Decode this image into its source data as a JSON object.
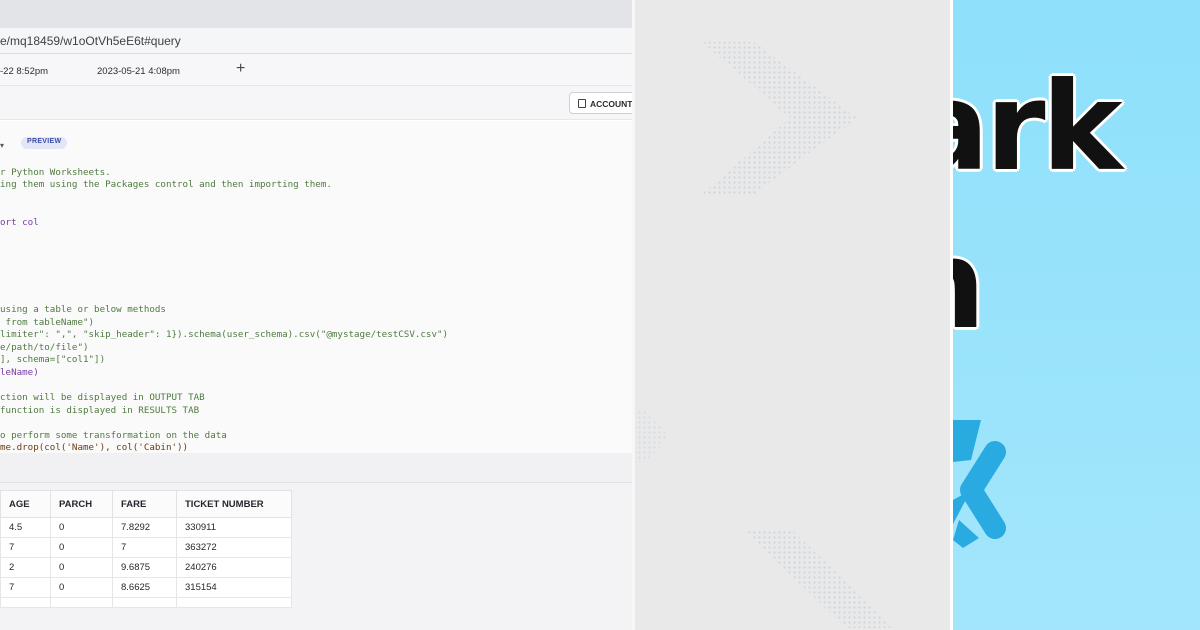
{
  "browser": {
    "address": "e/mq18459/w1oOtVh5eE6t#query"
  },
  "tabs": [
    {
      "label": "-22 8:52pm"
    },
    {
      "label": "2023-05-21 4:08pm"
    }
  ],
  "add_tab_glyph": "+",
  "toolbar": {
    "account_label": "ACCOUNT"
  },
  "editor": {
    "dropdown_glyph": "▾",
    "badge": "PREVIEW",
    "lines": [
      {
        "text": "r Python Worksheets.",
        "kind": "comment"
      },
      {
        "text": "ing them using the Packages control and then importing them.",
        "kind": "comment"
      },
      {
        "text": "ort col",
        "kind": "kw"
      },
      {
        "text": "using a table or below methods",
        "kind": "comment"
      },
      {
        "text": " from tableName\")",
        "kind": "comment"
      },
      {
        "text": "limiter\": \",\", \"skip_header\": 1}).schema(user_schema).csv(\"@mystage/testCSV.csv\")",
        "kind": "mixed"
      },
      {
        "text": "e/path/to/file\")",
        "kind": "comment"
      },
      {
        "text": "], schema=[\"col1\"])",
        "kind": "mixed"
      },
      {
        "text": "leName)",
        "kind": "plain"
      },
      {
        "text": "ction will be displayed in OUTPUT TAB",
        "kind": "comment"
      },
      {
        "text": "function is displayed in RESULTS TAB",
        "kind": "comment"
      },
      {
        "text": "o perform some transformation on the data",
        "kind": "comment"
      },
      {
        "text": "me.drop(col('Name'), col('Cabin'))",
        "kind": "fn"
      }
    ]
  },
  "results": {
    "columns": [
      "AGE",
      "PARCH",
      "FARE",
      "TICKET NUMBER"
    ],
    "rows": [
      [
        "4.5",
        "0",
        "7.8292",
        "330911"
      ],
      [
        "7",
        "0",
        "7",
        "363272"
      ],
      [
        "2",
        "0",
        "9.6875",
        "240276"
      ],
      [
        "7",
        "0",
        "8.6625",
        "315154"
      ],
      [
        "",
        "",
        "",
        ""
      ]
    ]
  },
  "title_panel": {
    "line1": "ark",
    "line2": "n",
    "background_color": "#9be4fb",
    "logo_color": "#29abe2"
  }
}
